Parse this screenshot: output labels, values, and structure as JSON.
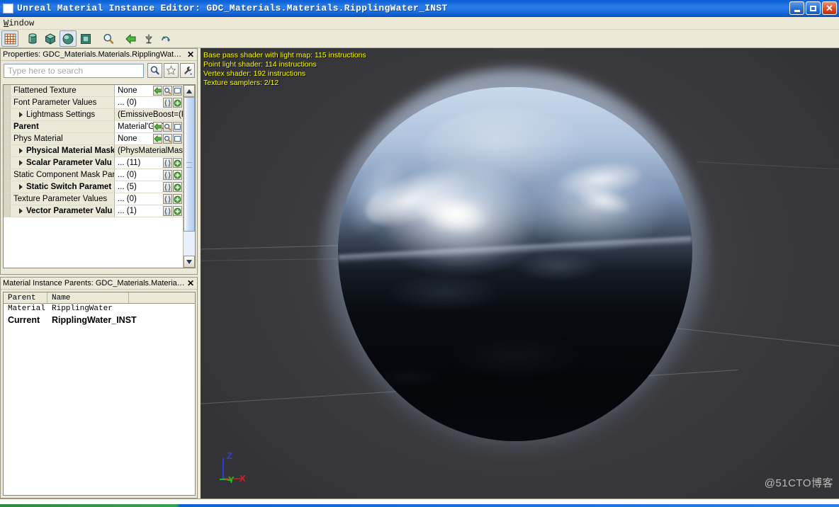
{
  "window": {
    "title": "Unreal Material Instance Editor: GDC_Materials.Materials.RipplingWater_INST",
    "icon": "app-window-icon",
    "minimize_label": "",
    "maximize_label": "",
    "close_label": "✕"
  },
  "menubar": {
    "items": [
      {
        "label": "Window",
        "accel": "W"
      }
    ]
  },
  "toolbar": {
    "buttons": [
      {
        "name": "grid-toggle-button",
        "icon": "grid-icon",
        "selected": true
      },
      {
        "name": "cylinder-preview-button",
        "icon": "cylinder-icon",
        "selected": false
      },
      {
        "name": "cube-preview-button",
        "icon": "cube-icon",
        "selected": false
      },
      {
        "name": "sphere-preview-button",
        "icon": "sphere-icon",
        "selected": true
      },
      {
        "name": "plane-preview-button",
        "icon": "plane-icon",
        "selected": false
      },
      {
        "name": "zoom-button",
        "icon": "magnifier-icon",
        "selected": false
      },
      {
        "name": "back-button",
        "icon": "green-left-arrow-icon",
        "selected": false
      },
      {
        "name": "light-button",
        "icon": "light-stand-icon",
        "selected": false
      },
      {
        "name": "sync-button",
        "icon": "sync-arrows-icon",
        "selected": false
      }
    ]
  },
  "properties_panel": {
    "caption": "Properties: GDC_Materials.Materials.RipplingWater_INST",
    "close_label": "✕",
    "search": {
      "placeholder": "Type here to search",
      "value": "",
      "buttons": [
        {
          "name": "search-button",
          "icon": "magnifier-icon"
        },
        {
          "name": "favorites-button",
          "icon": "star-icon"
        },
        {
          "name": "options-button",
          "icon": "wrench-icon"
        }
      ]
    },
    "rows": [
      {
        "name": "Flattened Texture",
        "value": "None",
        "expandable": false,
        "bold": false,
        "shaded": false,
        "icons": [
          "green-left-arrow-icon",
          "magnifier-icon",
          "clear-box-icon"
        ]
      },
      {
        "name": "Font Parameter Values",
        "value": "... (0)",
        "expandable": false,
        "bold": false,
        "shaded": false,
        "icons": [
          "braces-icon",
          "green-plus-icon"
        ]
      },
      {
        "name": "Lightmass Settings",
        "value": "(EmissiveBoost=(Pa",
        "expandable": true,
        "bold": false,
        "shaded": true,
        "icons": []
      },
      {
        "name": "Parent",
        "value": "Material'GDC",
        "expandable": false,
        "bold": true,
        "shaded": false,
        "icons": [
          "green-left-arrow-icon",
          "magnifier-icon",
          "clear-box-icon"
        ]
      },
      {
        "name": "Phys Material",
        "value": "None",
        "expandable": false,
        "bold": false,
        "shaded": false,
        "icons": [
          "green-left-arrow-icon",
          "magnifier-icon",
          "clear-box-icon"
        ]
      },
      {
        "name": "Physical Material Mask",
        "value": "(PhysMaterialMask",
        "expandable": true,
        "bold": true,
        "shaded": true,
        "icons": []
      },
      {
        "name": "Scalar Parameter Valu",
        "value": "... (11)",
        "expandable": true,
        "bold": true,
        "shaded": false,
        "icons": [
          "braces-icon",
          "green-plus-icon"
        ]
      },
      {
        "name": "Static Component Mask Par.",
        "value": "... (0)",
        "expandable": false,
        "bold": false,
        "shaded": false,
        "icons": [
          "braces-icon",
          "green-plus-icon"
        ]
      },
      {
        "name": "Static Switch Paramet",
        "value": "... (5)",
        "expandable": true,
        "bold": true,
        "shaded": false,
        "icons": [
          "braces-icon",
          "green-plus-icon"
        ]
      },
      {
        "name": "Texture Parameter Values",
        "value": "... (0)",
        "expandable": false,
        "bold": false,
        "shaded": false,
        "icons": [
          "braces-icon",
          "green-plus-icon"
        ]
      },
      {
        "name": "Vector Parameter Valu",
        "value": "... (1)",
        "expandable": true,
        "bold": true,
        "shaded": false,
        "icons": [
          "braces-icon",
          "green-plus-icon"
        ]
      }
    ],
    "scrollbar": {
      "up_arrow": "▲",
      "down_arrow": "▼"
    }
  },
  "parents_panel": {
    "caption": "Material Instance Parents: GDC_Materials.Materials.Rip...",
    "close_label": "✕",
    "columns": [
      "Parent",
      "Name"
    ],
    "rows": [
      {
        "parent": "Material",
        "name": "RipplingWater",
        "current": false
      },
      {
        "parent": "Current",
        "name": "RipplingWater_INST",
        "current": true
      }
    ]
  },
  "viewport": {
    "stats": [
      "Base pass shader with light map: 115 instructions",
      "Point light shader: 114 instructions",
      "Vertex shader: 192 instructions",
      "Texture samplers: 2/12"
    ],
    "stats_color": "#ffff00",
    "background_color": "#3a3a3d",
    "gizmo": {
      "z_label": "Z",
      "z_color": "#2b3fe0",
      "y_label": "Y",
      "y_color": "#18c018",
      "x_label": "X",
      "x_color": "#d02020"
    },
    "watermark": "@51CTO博客"
  }
}
